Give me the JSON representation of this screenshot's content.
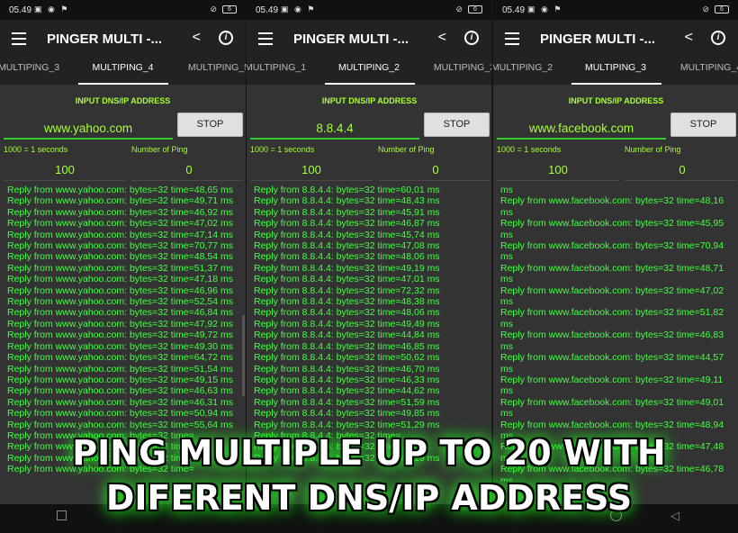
{
  "status_bar": [
    {
      "time": "05.49",
      "battery": "6"
    },
    {
      "time": "05.49",
      "battery": "6"
    },
    {
      "time": "05.49",
      "battery": "6"
    }
  ],
  "app": {
    "title": "PINGER MULTI -..."
  },
  "phones": [
    {
      "tabs": [
        "MULTIPING_3",
        "MULTIPING_4",
        "MULTIPING_5"
      ],
      "input_label": "INPUT DNS/IP ADDRESS",
      "host": "www.yahoo.com",
      "button": "STOP",
      "interval_label": "1000 = 1 seconds",
      "count_label": "Number of Ping",
      "interval": "100",
      "count": "0",
      "log": [
        "Reply from www.yahoo.com: bytes=32 time=48,65 ms",
        "Reply from www.yahoo.com: bytes=32 time=49,71 ms",
        "Reply from www.yahoo.com: bytes=32 time=46,92 ms",
        "Reply from www.yahoo.com: bytes=32 time=47,02 ms",
        "Reply from www.yahoo.com: bytes=32 time=47,14 ms",
        "Reply from www.yahoo.com: bytes=32 time=70,77 ms",
        "Reply from www.yahoo.com: bytes=32 time=48,54 ms",
        "Reply from www.yahoo.com: bytes=32 time=51,37 ms",
        "Reply from www.yahoo.com: bytes=32 time=47,18 ms",
        "Reply from www.yahoo.com: bytes=32 time=46,96 ms",
        "Reply from www.yahoo.com: bytes=32 time=52,54 ms",
        "Reply from www.yahoo.com: bytes=32 time=46,84 ms",
        "Reply from www.yahoo.com: bytes=32 time=47,92 ms",
        "Reply from www.yahoo.com: bytes=32 time=49,72 ms",
        "Reply from www.yahoo.com: bytes=32 time=49,30 ms",
        "Reply from www.yahoo.com: bytes=32 time=64,72 ms",
        "Reply from www.yahoo.com: bytes=32 time=51,54 ms",
        "Reply from www.yahoo.com: bytes=32 time=49,15 ms",
        "Reply from www.yahoo.com: bytes=32 time=46,63 ms",
        "Reply from www.yahoo.com: bytes=32 time=46,31 ms",
        "Reply from www.yahoo.com: bytes=32 time=50,94 ms",
        "Reply from www.yahoo.com: bytes=32 time=55,64 ms",
        "Reply from www.yahoo.com: bytes=32 time=",
        "Reply from www.yahoo.com: bytes=32 time=",
        "Reply from www.yahoo.com: bytes=32 time=",
        "Reply from www.yahoo.com: bytes=32 time="
      ]
    },
    {
      "tabs": [
        "MULTIPING_1",
        "MULTIPING_2",
        "MULTIPING_3"
      ],
      "input_label": "INPUT DNS/IP ADDRESS",
      "host": "8.8.4.4",
      "button": "STOP",
      "interval_label": "1000 = 1 seconds",
      "count_label": "Number of Ping",
      "interval": "100",
      "count": "0",
      "log": [
        "Reply from 8.8.4.4: bytes=32 time=60,01 ms",
        "Reply from 8.8.4.4: bytes=32 time=48,43 ms",
        "Reply from 8.8.4.4: bytes=32 time=45,91 ms",
        "Reply from 8.8.4.4: bytes=32 time=46,87 ms",
        "Reply from 8.8.4.4: bytes=32 time=45,74 ms",
        "Reply from 8.8.4.4: bytes=32 time=47,08 ms",
        "Reply from 8.8.4.4: bytes=32 time=48,06 ms",
        "Reply from 8.8.4.4: bytes=32 time=49,19 ms",
        "Reply from 8.8.4.4: bytes=32 time=47,01 ms",
        "Reply from 8.8.4.4: bytes=32 time=72,32 ms",
        "Reply from 8.8.4.4: bytes=32 time=48,38 ms",
        "Reply from 8.8.4.4: bytes=32 time=48,06 ms",
        "Reply from 8.8.4.4: bytes=32 time=49,49 ms",
        "Reply from 8.8.4.4: bytes=32 time=44,84 ms",
        "Reply from 8.8.4.4: bytes=32 time=46,85 ms",
        "Reply from 8.8.4.4: bytes=32 time=50,62 ms",
        "Reply from 8.8.4.4: bytes=32 time=46,70 ms",
        "Reply from 8.8.4.4: bytes=32 time=46,33 ms",
        "Reply from 8.8.4.4: bytes=32 time=44,62 ms",
        "Reply from 8.8.4.4: bytes=32 time=51,59 ms",
        "Reply from 8.8.4.4: bytes=32 time=49,85 ms",
        "Reply from 8.8.4.4: bytes=32 time=51,29 ms",
        "Reply from 8.8.4.4: bytes=32 time=",
        "Reply from 8.8.4.4: bytes=32 time=",
        "Reply from 8.8.4.4: bytes=32 time=44,19 ms"
      ]
    },
    {
      "tabs": [
        "MULTIPING_2",
        "MULTIPING_3",
        "MULTIPING_4"
      ],
      "input_label": "INPUT DNS/IP ADDRESS",
      "host": "www.facebook.com",
      "button": "STOP",
      "interval_label": "1000 = 1 seconds",
      "count_label": "Number of Ping",
      "interval": "100",
      "count": "0",
      "log": [
        "ms",
        "Reply from www.facebook.com: bytes=32 time=48,16 ms",
        "Reply from www.facebook.com: bytes=32 time=45,95 ms",
        "Reply from www.facebook.com: bytes=32 time=70,94 ms",
        "Reply from www.facebook.com: bytes=32 time=48,71 ms",
        "Reply from www.facebook.com: bytes=32 time=47,02 ms",
        "Reply from www.facebook.com: bytes=32 time=51,82 ms",
        "Reply from www.facebook.com: bytes=32 time=46,83 ms",
        "Reply from www.facebook.com: bytes=32 time=44,57 ms",
        "Reply from www.facebook.com: bytes=32 time=49,11 ms",
        "Reply from www.facebook.com: bytes=32 time=49,01 ms",
        "Reply from www.facebook.com: bytes=32 time=48,94 ms",
        "Reply from www.facebook.com: bytes=32 time=47,48 ms",
        "Reply from www.facebook.com: bytes=32 time=46,78 ms"
      ]
    }
  ],
  "banner": {
    "line1": "PING MULTIPLE UP TO 20 WITH",
    "line2": "DIFERENT DNS/IP ADDRESS"
  },
  "colors": {
    "accent": "#a6ff33",
    "log_text": "#44ff44",
    "glow": "#22ff22",
    "panel": "#333333"
  },
  "icons": [
    "menu-icon",
    "share-icon",
    "info-icon",
    "wifi-icon",
    "battery-icon"
  ]
}
